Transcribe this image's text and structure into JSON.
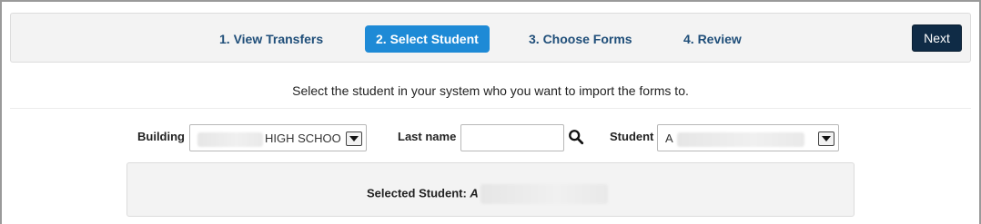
{
  "steps": [
    {
      "label": "1. View Transfers",
      "active": false
    },
    {
      "label": "2. Select Student",
      "active": true
    },
    {
      "label": "3. Choose Forms",
      "active": false
    },
    {
      "label": "4. Review",
      "active": false
    }
  ],
  "next_label": "Next",
  "instruction": "Select the student in your system who you want to import the forms to.",
  "building": {
    "label": "Building",
    "value_visible": "HIGH SCHOO"
  },
  "last_name": {
    "label": "Last name",
    "value": "",
    "placeholder": ""
  },
  "student": {
    "label": "Student",
    "value_visible": "A"
  },
  "selected_student": {
    "label": "Selected Student:",
    "value_visible": "A"
  },
  "colors": {
    "accent": "#1e8ad6",
    "next_button": "#0f2b46",
    "step_text": "#1f4e79"
  }
}
